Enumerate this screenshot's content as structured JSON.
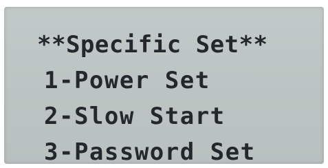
{
  "screen": {
    "background_color": "#bec6c5",
    "text_color": "#24282c"
  },
  "menu": {
    "title": "**Specific Set**",
    "items": [
      {
        "label": "1-Power Set"
      },
      {
        "label": "2-Slow Start"
      },
      {
        "label": "3-Password Set"
      }
    ]
  }
}
